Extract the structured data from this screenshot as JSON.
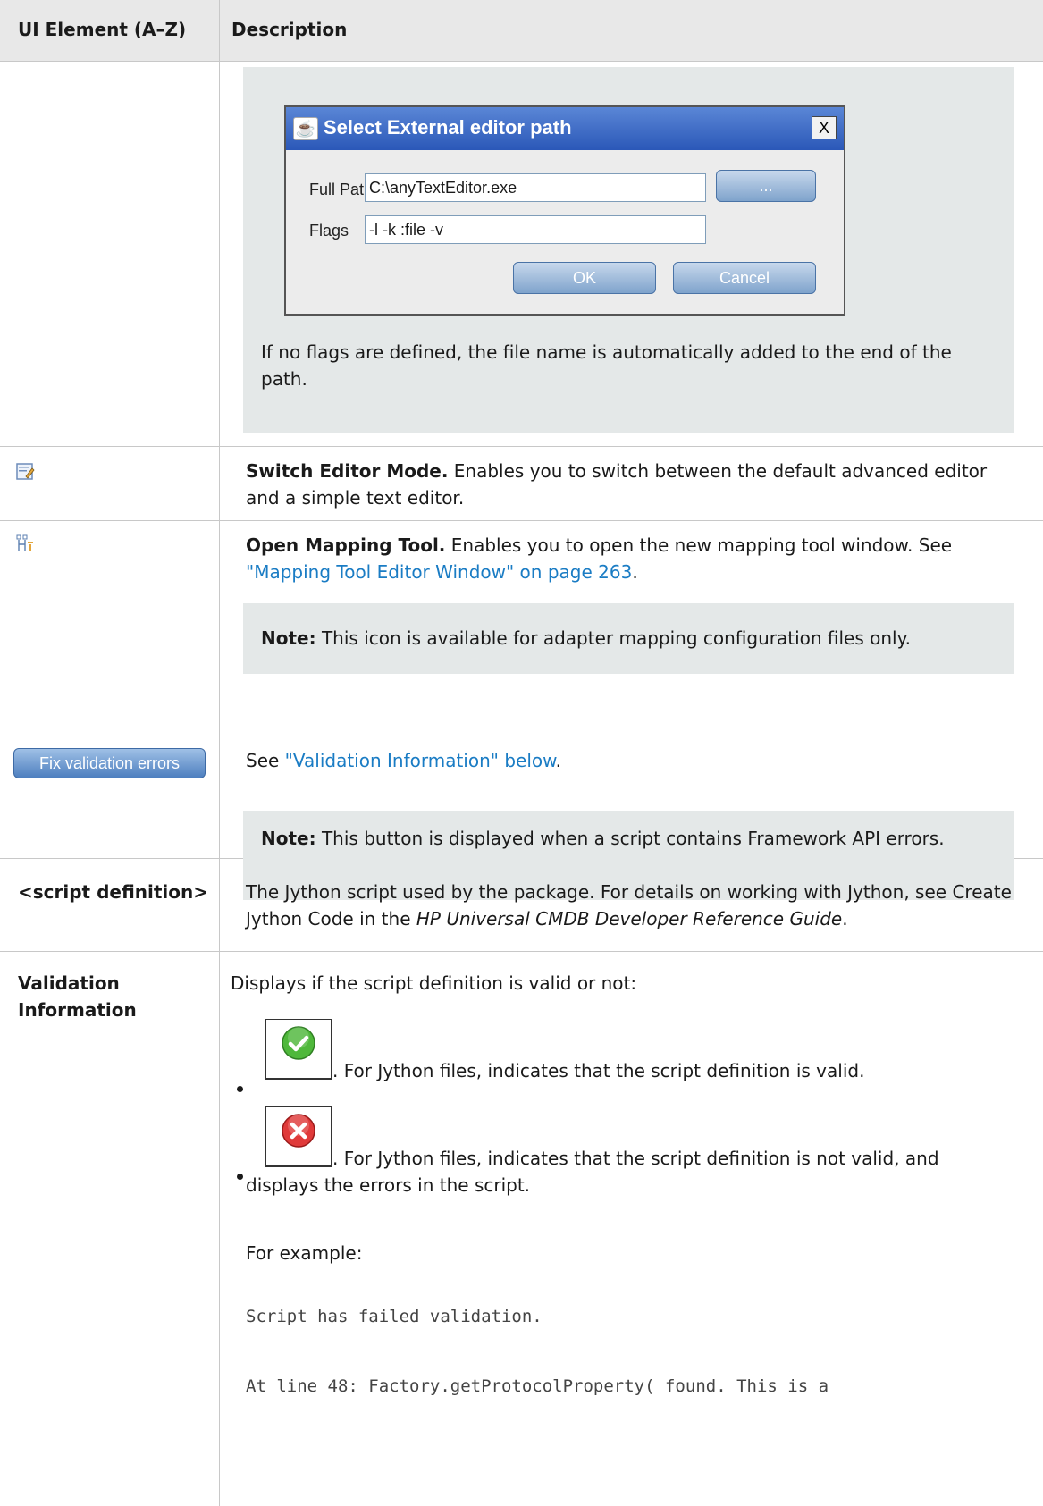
{
  "header": {
    "col1": "UI Element (A–Z)",
    "col2": "Description"
  },
  "dialog": {
    "title": "Select External editor path",
    "close_glyph": "X",
    "full_path_label": "Full Path",
    "full_path_value": "C:\\anyTextEditor.exe",
    "browse_label": "...",
    "flags_label": "Flags",
    "flags_value": "-l -k :file -v",
    "ok_label": "OK",
    "cancel_label": "Cancel"
  },
  "row0": {
    "text": "If no flags are defined, the file name is automatically added to the end of the path."
  },
  "row1": {
    "icon": "switch-editor-mode-icon",
    "title": "Switch Editor Mode.",
    "text": "Enables you to switch between the default advanced editor and a simple text editor."
  },
  "row2": {
    "icon": "mapping-tool-icon",
    "title": "Open Mapping Tool.",
    "text": "Enables you to open the new mapping tool window. See",
    "link": "\"Mapping Tool Editor Window\" on page 263",
    "note_label": "Note:",
    "note_text": "This icon is available for adapter mapping configuration files only."
  },
  "row3": {
    "button_label": "Fix validation errors",
    "see": "See",
    "link": "\"Validation Information\" below",
    "note_label": "Note:",
    "note_text": "This button is displayed when a script contains Framework API errors."
  },
  "row4": {
    "name": "<script definition>",
    "text_a": "The Jython script used by the package. For details on working with Jython, see Create Jython Code in the",
    "text_italic": "HP Universal CMDB Developer Reference Guide",
    "text_b": "."
  },
  "row5": {
    "name": "Validation Information",
    "intro": "Displays if the script definition is valid or not:",
    "valid_text": ". For Jython files, indicates that the script definition is valid.",
    "invalid_text": ". For Jython files, indicates that the script definition is not valid, and displays the errors in the script.",
    "example_label": "For example:",
    "code_line1": "Script has failed validation.",
    "code_line2": "At line 48: Factory.getProtocolProperty( found. This is a"
  },
  "colors": {
    "link": "#1a7cc4",
    "note_bg": "#e4e8e8",
    "header_bg": "#e8e8e8"
  }
}
